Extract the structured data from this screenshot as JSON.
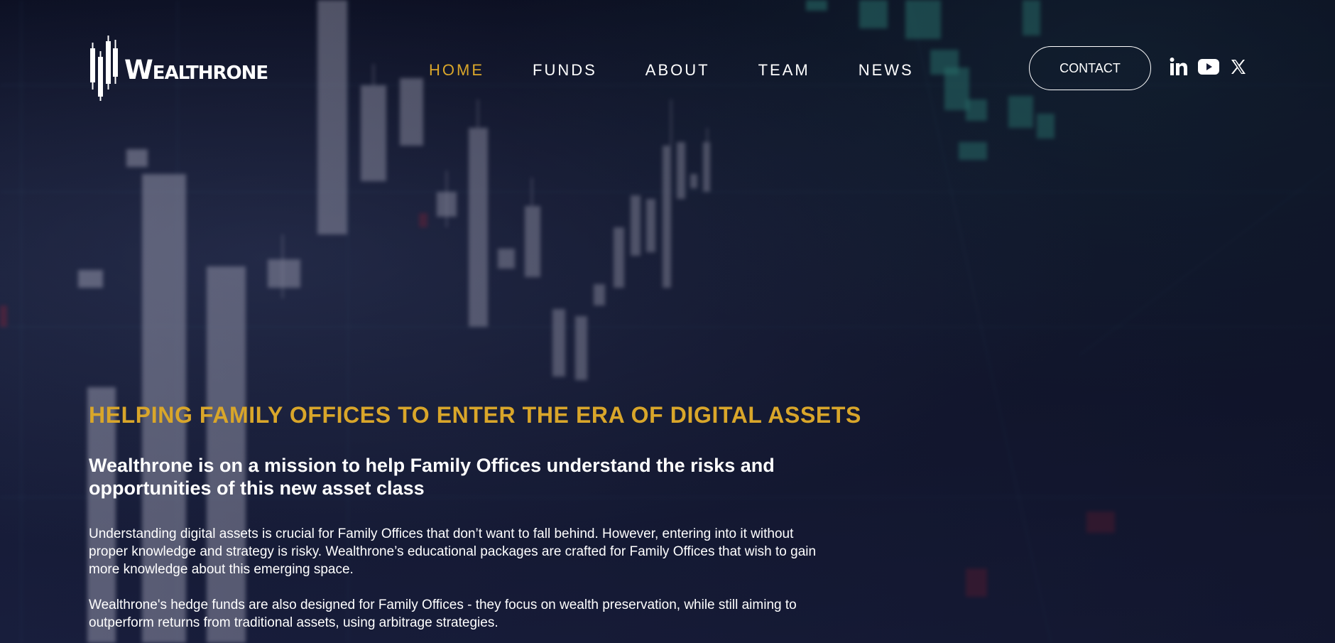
{
  "logo": {
    "text": "Wealthrone",
    "icon": "candlestick-w-icon"
  },
  "nav": {
    "items": [
      {
        "label": "HOME",
        "active": true
      },
      {
        "label": "FUNDS",
        "active": false
      },
      {
        "label": "ABOUT",
        "active": false
      },
      {
        "label": "TEAM",
        "active": false
      },
      {
        "label": "NEWS",
        "active": false
      }
    ]
  },
  "header": {
    "contact_label": "CONTACT",
    "social_icons": [
      "linkedin-icon",
      "youtube-icon",
      "x-icon"
    ]
  },
  "hero": {
    "heading": "HELPING FAMILY OFFICES TO ENTER THE ERA OF DIGITAL ASSETS",
    "subheading": "Wealthrone is on a mission to help Family Offices understand the risks and opportunities of this new asset class",
    "paragraph_1": "Understanding digital assets is crucial for  Family Offices that don’t want to fall behind. However, entering into it without proper knowledge and strategy is risky. Wealthrone’s educational packages are crafted for Family Offices that wish to gain more knowledge about this emerging space.",
    "paragraph_2": "Wealthrone's hedge funds are also designed for Family Offices - they focus on wealth preservation, while still aiming to outperform returns from traditional assets, using arbitrage strategies."
  },
  "colors": {
    "accent": "#d9a62a",
    "text": "#ffffff",
    "background": "#141a33",
    "chart_teal": "#3fbfa8"
  }
}
